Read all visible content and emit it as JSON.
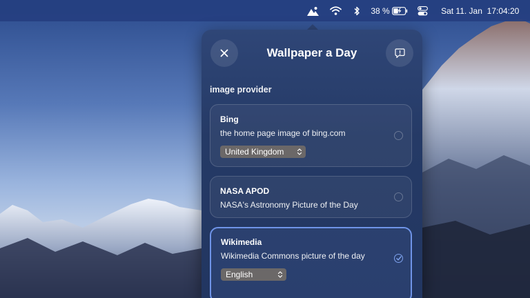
{
  "menubar": {
    "battery_percent": "38 %",
    "date": "Sat 11. Jan",
    "time": "17:04:20",
    "icons": [
      "wallpaper-app-icon",
      "wifi-icon",
      "bluetooth-icon",
      "battery-charging-icon",
      "control-center-icon"
    ]
  },
  "popover": {
    "title": "Wallpaper a Day",
    "close_icon": "close-icon",
    "feedback_icon": "feedback-icon",
    "section_label": "image provider",
    "providers": [
      {
        "title": "Bing",
        "description": "the home page image of bing.com",
        "selected": false,
        "select_value": "United Kingdom"
      },
      {
        "title": "NASA APOD",
        "description": "NASA's Astronomy Picture of the Day",
        "selected": false
      },
      {
        "title": "Wikimedia",
        "description": "Wikimedia Commons picture of the day",
        "selected": true,
        "select_value": "English"
      }
    ]
  },
  "colors": {
    "menubar": "#253f80",
    "popover": "#2f4677",
    "accent": "#7fa3ef",
    "select_bg": "#6b6868"
  }
}
